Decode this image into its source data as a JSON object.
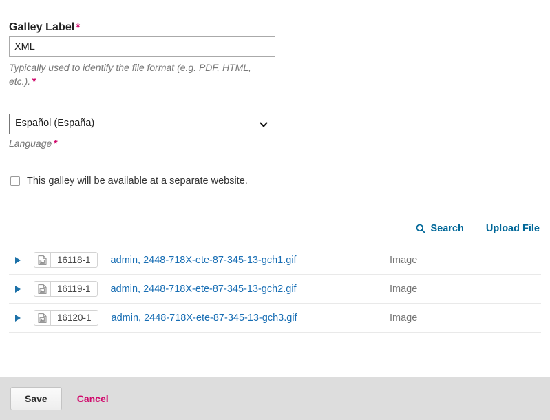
{
  "form": {
    "galley_label": {
      "label": "Galley Label",
      "required_marker": "*",
      "value": "XML",
      "placeholder": "",
      "hint": "Typically used to identify the file format (e.g. PDF, HTML, etc.).",
      "hint_required_marker": "*"
    },
    "language": {
      "selected": "Español (España)",
      "label": "Language",
      "required_marker": "*",
      "arrow_icon": "chevron-down-icon",
      "options": [
        "Español (España)"
      ]
    },
    "remote_galley": {
      "checked": false,
      "label": "This galley will be available at a separate website."
    }
  },
  "toolbar": {
    "search": {
      "label": "Search",
      "icon": "search-icon"
    },
    "upload": {
      "label": "Upload File"
    }
  },
  "files": {
    "type_column_header": "",
    "rows": [
      {
        "expander_icon": "triangle-right-icon",
        "file_icon": "image-file-icon",
        "id": "16118-1",
        "name": "admin, 2448-718X-ete-87-345-13-gch1.gif",
        "type": "Image"
      },
      {
        "expander_icon": "triangle-right-icon",
        "file_icon": "image-file-icon",
        "id": "16119-1",
        "name": "admin, 2448-718X-ete-87-345-13-gch2.gif",
        "type": "Image"
      },
      {
        "expander_icon": "triangle-right-icon",
        "file_icon": "image-file-icon",
        "id": "16120-1",
        "name": "admin, 2448-718X-ete-87-345-13-gch3.gif",
        "type": "Image"
      }
    ]
  },
  "footer": {
    "save_label": "Save",
    "cancel_label": "Cancel"
  },
  "colors": {
    "accent_pink": "#d00a6c",
    "link_blue": "#006798",
    "file_link_blue": "#186eb4",
    "footer_bg": "#dddddd"
  }
}
